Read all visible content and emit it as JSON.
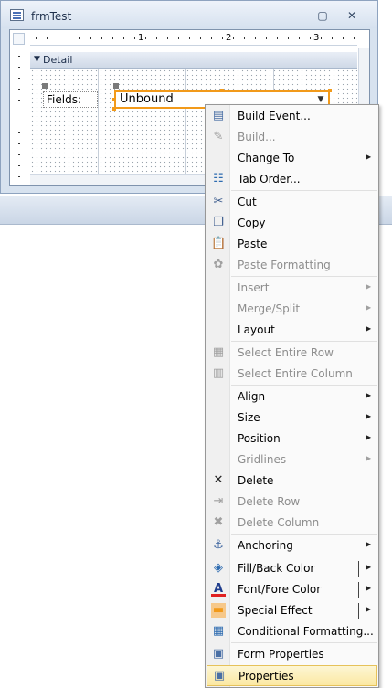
{
  "window": {
    "title": "frmTest",
    "controls": {
      "minimize": "–",
      "maximize": "▢",
      "close": "✕"
    }
  },
  "ruler": {
    "numbers": [
      "1",
      "2",
      "3"
    ]
  },
  "section": {
    "detail_label": "Detail"
  },
  "form": {
    "label_text": "Fields:",
    "combo_value": "Unbound"
  },
  "colors": {
    "selection_accent": "#f29a1a",
    "menu_highlight": "#fbe8a2",
    "window_chrome": "#d7e2ef"
  },
  "context_menu": {
    "items": [
      {
        "label": "Build Event...",
        "icon": "build-event-icon",
        "enabled": true,
        "submenu": false
      },
      {
        "label": "Build...",
        "icon": "build-wand-icon",
        "enabled": false,
        "submenu": false
      },
      {
        "label": "Change To",
        "icon": "",
        "enabled": true,
        "submenu": true
      },
      {
        "label": "Tab Order...",
        "icon": "tab-order-icon",
        "enabled": true,
        "submenu": false
      },
      {
        "label": "Cut",
        "icon": "scissors-icon",
        "enabled": true,
        "submenu": false
      },
      {
        "label": "Copy",
        "icon": "copy-icon",
        "enabled": true,
        "submenu": false
      },
      {
        "label": "Paste",
        "icon": "paste-icon",
        "enabled": true,
        "submenu": false
      },
      {
        "label": "Paste Formatting",
        "icon": "paste-formatting-icon",
        "enabled": false,
        "submenu": false
      },
      {
        "label": "Insert",
        "icon": "",
        "enabled": false,
        "submenu": true
      },
      {
        "label": "Merge/Split",
        "icon": "",
        "enabled": false,
        "submenu": true
      },
      {
        "label": "Layout",
        "icon": "",
        "enabled": true,
        "submenu": true
      },
      {
        "label": "Select Entire Row",
        "icon": "select-row-icon",
        "enabled": false,
        "submenu": false
      },
      {
        "label": "Select Entire Column",
        "icon": "select-column-icon",
        "enabled": false,
        "submenu": false
      },
      {
        "label": "Align",
        "icon": "",
        "enabled": true,
        "submenu": true
      },
      {
        "label": "Size",
        "icon": "",
        "enabled": true,
        "submenu": true
      },
      {
        "label": "Position",
        "icon": "",
        "enabled": true,
        "submenu": true
      },
      {
        "label": "Gridlines",
        "icon": "",
        "enabled": false,
        "submenu": true
      },
      {
        "label": "Delete",
        "icon": "delete-x-icon",
        "enabled": true,
        "submenu": false
      },
      {
        "label": "Delete Row",
        "icon": "delete-row-icon",
        "enabled": false,
        "submenu": false
      },
      {
        "label": "Delete Column",
        "icon": "delete-column-icon",
        "enabled": false,
        "submenu": false
      },
      {
        "label": "Anchoring",
        "icon": "anchoring-icon",
        "enabled": true,
        "submenu": true
      },
      {
        "label": "Fill/Back Color",
        "icon": "fill-bucket-icon",
        "enabled": true,
        "submenu": true
      },
      {
        "label": "Font/Fore Color",
        "icon": "font-color-icon",
        "enabled": true,
        "submenu": true
      },
      {
        "label": "Special Effect",
        "icon": "special-effect-icon",
        "enabled": true,
        "submenu": true
      },
      {
        "label": "Conditional Formatting...",
        "icon": "conditional-formatting-icon",
        "enabled": true,
        "submenu": false
      },
      {
        "label": "Form Properties",
        "icon": "form-properties-icon",
        "enabled": true,
        "submenu": false
      },
      {
        "label": "Properties",
        "icon": "properties-icon",
        "enabled": true,
        "submenu": false,
        "highlighted": true
      }
    ]
  }
}
